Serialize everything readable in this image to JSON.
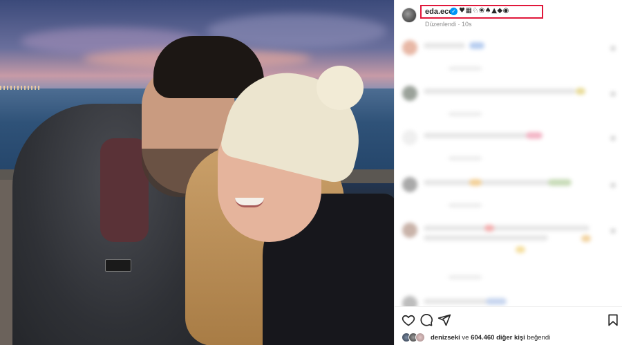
{
  "post": {
    "username": "eda.ece",
    "verified_mark": "✓",
    "bio_emojis": "♥▦♘❀♠▲◆◉",
    "edited_label": "Düzenlendi · 10s"
  },
  "actions": {
    "like_icon": "heart-outline-icon",
    "comment_icon": "speech-bubble-icon",
    "share_icon": "paper-plane-icon",
    "save_icon": "bookmark-icon"
  },
  "likes": {
    "liker": "denizseki",
    "conjunction": "ve",
    "others_count": "604.460 diğer kişi",
    "suffix": "beğendi"
  },
  "colors": {
    "highlight_box": "#e0173a",
    "verified": "#0095f6",
    "text_primary": "#262626",
    "text_secondary": "#8e8e8e"
  }
}
